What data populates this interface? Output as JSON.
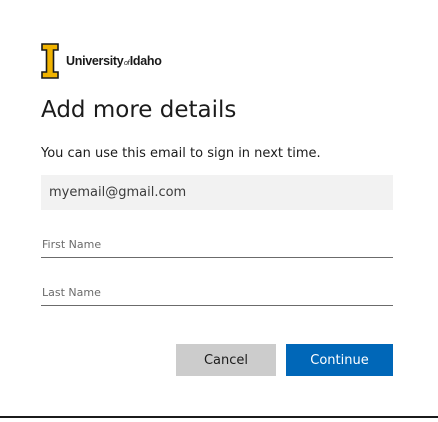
{
  "brand": {
    "logo_icon": "university-of-idaho-i-logo",
    "name_part1": "University",
    "name_of": "of",
    "name_part2": "Idaho",
    "gold": "#f1b300",
    "black": "#191919"
  },
  "page": {
    "title": "Add more details",
    "description": "You can use this email to sign in next time."
  },
  "email": {
    "value": "myemail@gmail.com"
  },
  "form": {
    "first_name_placeholder": "First Name",
    "first_name_value": "",
    "last_name_placeholder": "Last Name",
    "last_name_value": ""
  },
  "actions": {
    "cancel_label": "Cancel",
    "continue_label": "Continue",
    "primary_color": "#0067b8",
    "secondary_color": "#cccccc"
  }
}
